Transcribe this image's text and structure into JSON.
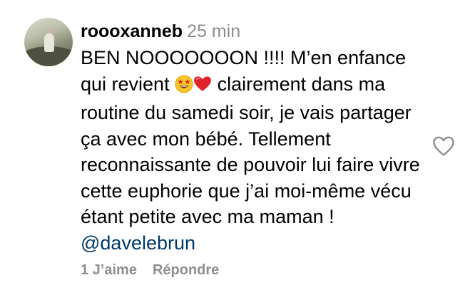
{
  "comment": {
    "username": "roooxanneb",
    "timestamp": "25 min",
    "text_before_emoji": "BEN NOOOOOOON !!!! M’en enfance qui revient ",
    "emojis": [
      "star-struck-emoji",
      "red-heart-emoji"
    ],
    "text_after_emoji": " clairement dans ma routine du samedi soir, je vais partager ça avec mon bébé. Tellement reconnaissante de pouvoir lui faire vivre cette euphorie que j’ai moi-même vécu étant petite avec ma maman ! ",
    "mention": "@davelebrun",
    "likes_label": "1 J’aime",
    "reply_label": "Répondre"
  },
  "colors": {
    "text": "#000000",
    "muted": "#8e8e8e",
    "mention": "#00376b",
    "heart": "#e0242c"
  },
  "icons": {
    "like": "heart-outline-icon"
  }
}
